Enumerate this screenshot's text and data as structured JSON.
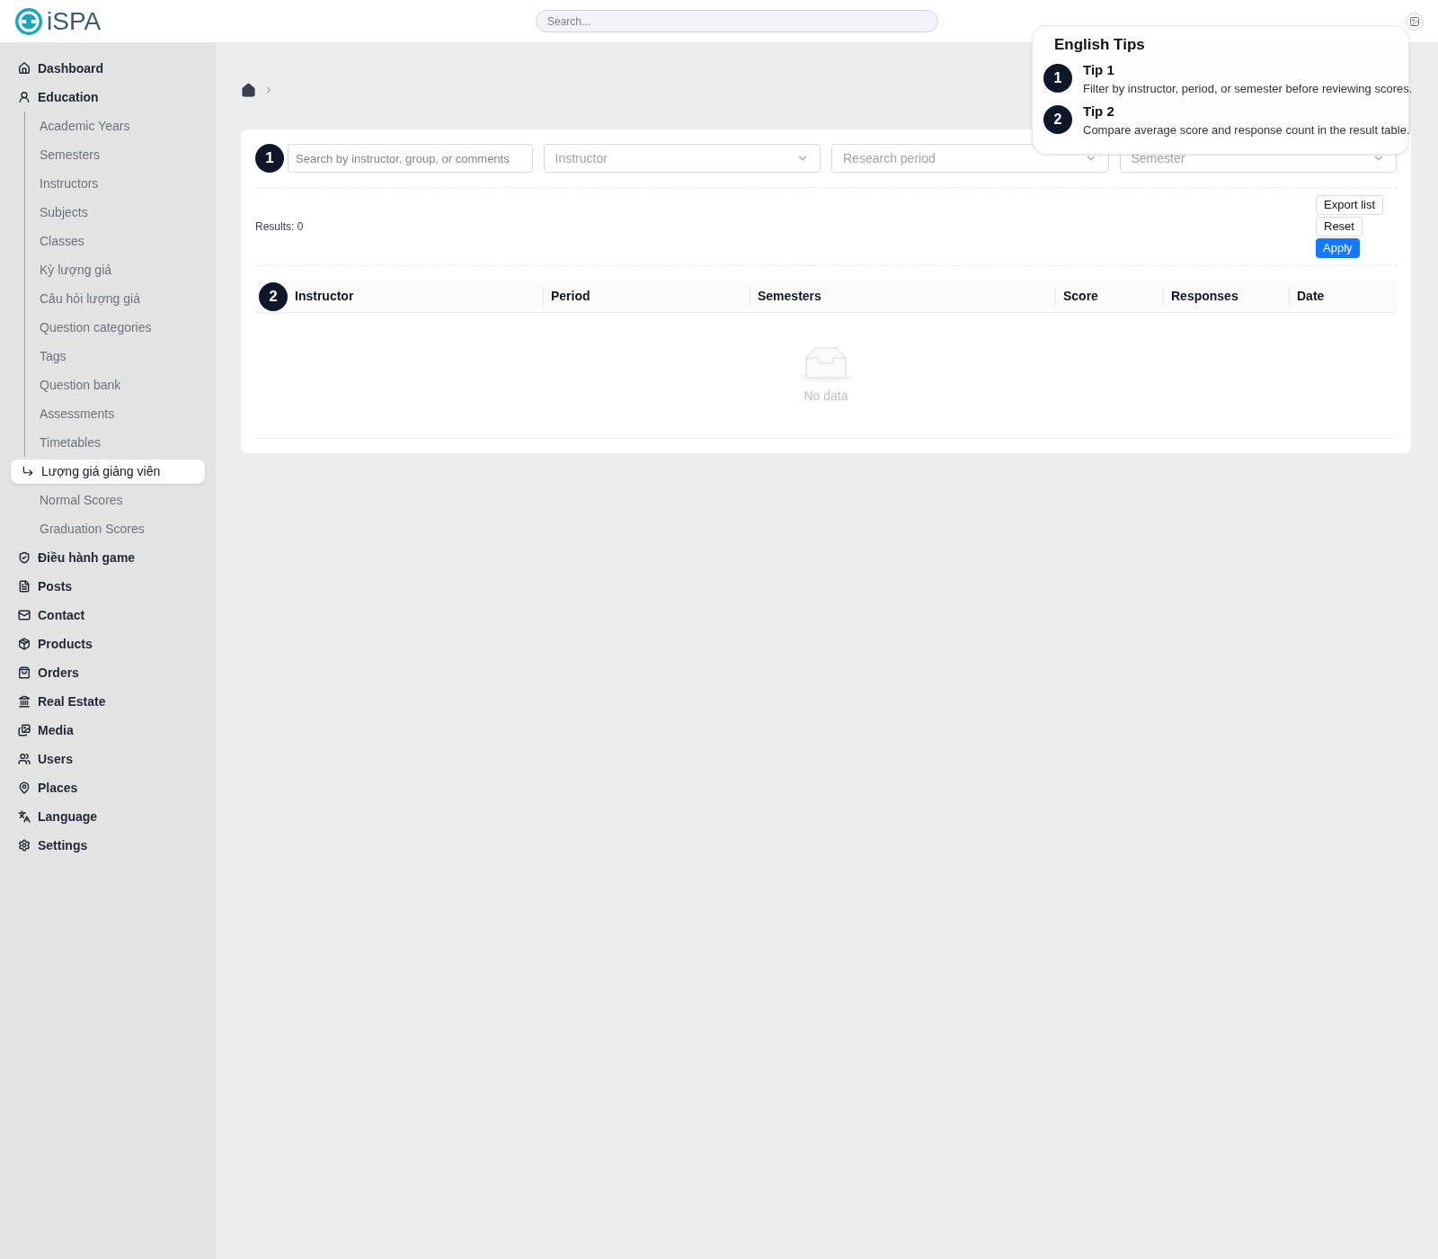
{
  "header": {
    "logo": "iSPA",
    "search": {
      "placeholder": "Search..."
    }
  },
  "sidebar": {
    "items": [
      {
        "label": "Dashboard",
        "selected": false
      },
      {
        "label": "Education",
        "selected": false,
        "children": [
          {
            "label": "Academic Years",
            "selected": false
          },
          {
            "label": "Semesters",
            "selected": false
          },
          {
            "label": "Instructors",
            "selected": false
          },
          {
            "label": "Subjects",
            "selected": false
          },
          {
            "label": "Classes",
            "selected": false
          },
          {
            "label": "Kỳ lượng giá",
            "selected": false
          },
          {
            "label": "Câu hỏi lượng giá",
            "selected": false
          },
          {
            "label": "Question categories",
            "selected": false
          },
          {
            "label": "Tags",
            "selected": false
          },
          {
            "label": "Question bank",
            "selected": false
          },
          {
            "label": "Assessments",
            "selected": false
          },
          {
            "label": "Timetables",
            "selected": false
          },
          {
            "label": "Lượng giá giảng viên",
            "selected": true
          },
          {
            "label": "Normal Scores",
            "selected": false
          },
          {
            "label": "Graduation Scores",
            "selected": false
          }
        ]
      },
      {
        "label": "Điều hành game",
        "selected": false
      },
      {
        "label": "Posts",
        "selected": false
      },
      {
        "label": "Contact",
        "selected": false
      },
      {
        "label": "Products",
        "selected": false
      },
      {
        "label": "Orders",
        "selected": false
      },
      {
        "label": "Real Estate",
        "selected": false
      },
      {
        "label": "Media",
        "selected": false
      },
      {
        "label": "Users",
        "selected": false
      },
      {
        "label": "Places",
        "selected": false
      },
      {
        "label": "Language",
        "selected": false
      },
      {
        "label": "Settings",
        "selected": false
      }
    ]
  },
  "step_markers": [
    "1",
    "2"
  ],
  "filters": {
    "search": {
      "placeholder": "Search by instructor, group, or comments"
    },
    "selects": [
      {
        "placeholder": "Instructor"
      },
      {
        "placeholder": "Research period"
      },
      {
        "placeholder": "Semester"
      }
    ]
  },
  "results": "Results: 0",
  "actions": [
    {
      "label": "Export list",
      "kind": "default"
    },
    {
      "label": "Reset",
      "kind": "default"
    },
    {
      "label": "Apply",
      "kind": "primary"
    }
  ],
  "table": {
    "columns": [
      "Instructor",
      "Period",
      "Semesters",
      "Score",
      "Responses",
      "Date"
    ],
    "empty": "No data"
  },
  "tour": {
    "title": "English Tips",
    "tips": [
      {
        "number": "1",
        "title": "Tip 1",
        "text": "Filter by instructor, period, or semester before reviewing scores."
      },
      {
        "number": "2",
        "title": "Tip 2",
        "text": "Compare average score and response count in the result table."
      }
    ]
  }
}
